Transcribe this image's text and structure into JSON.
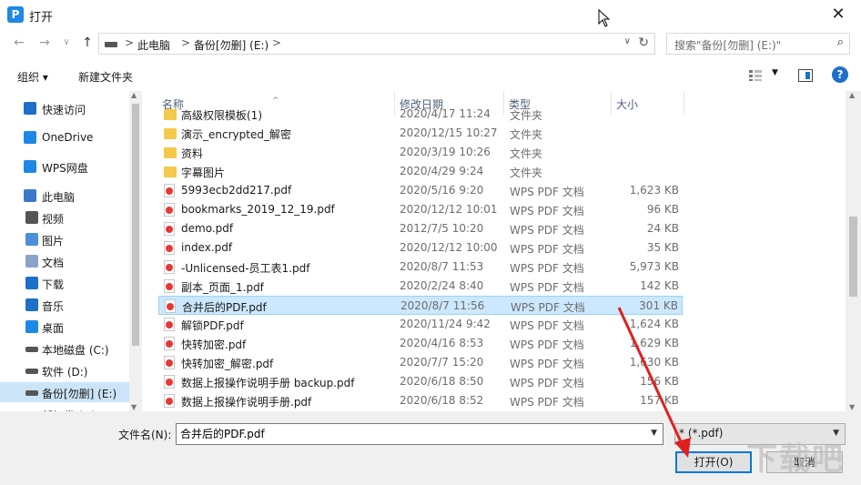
{
  "window": {
    "title": "打开",
    "app_logo": "P",
    "close_glyph": "✕"
  },
  "nav": {
    "back": "←",
    "forward": "→",
    "recent": "∨",
    "up": "↑",
    "breadcrumb": [
      "此电脑",
      "备份[勿删] (E:)"
    ],
    "sep": ">",
    "refresh": "↻",
    "dropdown": "∨",
    "search_placeholder": "搜索\"备份[勿删] (E:)\"",
    "search_icon": "⌕"
  },
  "toolbar": {
    "organize": "组织 ▾",
    "new_folder": "新建文件夹",
    "view_dd": "▼",
    "help": "?"
  },
  "sidebar": {
    "items": [
      {
        "label": "快速访问",
        "icon": "star-icon",
        "color": "#1e6fc9",
        "top": true
      },
      {
        "label": "OneDrive",
        "icon": "cloud-icon",
        "color": "#1e88e5",
        "top": true
      },
      {
        "label": "WPS网盘",
        "icon": "wps-cloud-icon",
        "color": "#1e88e5",
        "top": true
      },
      {
        "label": "此电脑",
        "icon": "computer-icon",
        "color": "#3c78c8",
        "top": true
      },
      {
        "label": "视频",
        "icon": "video-icon",
        "color": "#555555"
      },
      {
        "label": "图片",
        "icon": "picture-icon",
        "color": "#4a8fd8"
      },
      {
        "label": "文档",
        "icon": "document-icon",
        "color": "#8aa4c8"
      },
      {
        "label": "下载",
        "icon": "download-icon",
        "color": "#1e6fc9"
      },
      {
        "label": "音乐",
        "icon": "music-icon",
        "color": "#1e6fc9"
      },
      {
        "label": "桌面",
        "icon": "desktop-icon",
        "color": "#1e88e5"
      },
      {
        "label": "本地磁盘 (C:)",
        "icon": "drive-icon",
        "color": "#555555"
      },
      {
        "label": "软件 (D:)",
        "icon": "drive-icon",
        "color": "#555555"
      },
      {
        "label": "备份[勿删] (E:)",
        "icon": "drive-icon",
        "color": "#555555",
        "selected": true
      },
      {
        "label": "新加卷 (F:)",
        "icon": "drive-icon",
        "color": "#555555"
      }
    ]
  },
  "columns": {
    "name": "名称",
    "date": "修改日期",
    "type": "类型",
    "size": "大小"
  },
  "files": [
    {
      "name": "高级权限模板(1)",
      "date": "2020/4/17 11:24",
      "type": "文件夹",
      "size": "",
      "kind": "folder"
    },
    {
      "name": "演示_encrypted_解密",
      "date": "2020/12/15 10:27",
      "type": "文件夹",
      "size": "",
      "kind": "folder"
    },
    {
      "name": "资料",
      "date": "2020/3/19 10:26",
      "type": "文件夹",
      "size": "",
      "kind": "folder"
    },
    {
      "name": "字幕图片",
      "date": "2020/4/29 9:24",
      "type": "文件夹",
      "size": "",
      "kind": "folder"
    },
    {
      "name": "5993ecb2dd217.pdf",
      "date": "2020/5/16 9:20",
      "type": "WPS PDF 文档",
      "size": "1,623 KB",
      "kind": "pdf"
    },
    {
      "name": "bookmarks_2019_12_19.pdf",
      "date": "2020/12/12 10:01",
      "type": "WPS PDF 文档",
      "size": "96 KB",
      "kind": "pdf"
    },
    {
      "name": "demo.pdf",
      "date": "2012/7/5 10:20",
      "type": "WPS PDF 文档",
      "size": "24 KB",
      "kind": "pdf"
    },
    {
      "name": "index.pdf",
      "date": "2020/12/12 10:00",
      "type": "WPS PDF 文档",
      "size": "35 KB",
      "kind": "pdf"
    },
    {
      "name": "-Unlicensed-员工表1.pdf",
      "date": "2020/8/7 11:53",
      "type": "WPS PDF 文档",
      "size": "5,973 KB",
      "kind": "pdf"
    },
    {
      "name": "副本_页面_1.pdf",
      "date": "2020/2/24 8:40",
      "type": "WPS PDF 文档",
      "size": "142 KB",
      "kind": "pdf"
    },
    {
      "name": "合并后的PDF.pdf",
      "date": "2020/8/7 11:56",
      "type": "WPS PDF 文档",
      "size": "301 KB",
      "kind": "pdf",
      "selected": true
    },
    {
      "name": "解锁PDF.pdf",
      "date": "2020/11/24 9:42",
      "type": "WPS PDF 文档",
      "size": "1,624 KB",
      "kind": "pdf"
    },
    {
      "name": "快转加密.pdf",
      "date": "2020/4/16 8:53",
      "type": "WPS PDF 文档",
      "size": "1,629 KB",
      "kind": "pdf"
    },
    {
      "name": "快转加密_解密.pdf",
      "date": "2020/7/7 15:20",
      "type": "WPS PDF 文档",
      "size": "1,630 KB",
      "kind": "pdf"
    },
    {
      "name": "数据上报操作说明手册 backup.pdf",
      "date": "2020/6/18 8:50",
      "type": "WPS PDF 文档",
      "size": "156 KB",
      "kind": "pdf"
    },
    {
      "name": "数据上报操作说明手册.pdf",
      "date": "2020/6/18 8:52",
      "type": "WPS PDF 文档",
      "size": "157 KB",
      "kind": "pdf"
    }
  ],
  "footer": {
    "filename_label": "文件名(N):",
    "filename_value": "合并后的PDF.pdf",
    "filetype_value": "* (*.pdf)",
    "open_button": "打开(O)",
    "cancel_button": "取消",
    "dd": "▼"
  },
  "scroll": {
    "up": "▲",
    "down": "▼"
  },
  "watermark": "下载吧",
  "colors": {
    "accent": "#0078d7",
    "selection": "#cce8ff",
    "annotation_arrow": "#e02020"
  }
}
